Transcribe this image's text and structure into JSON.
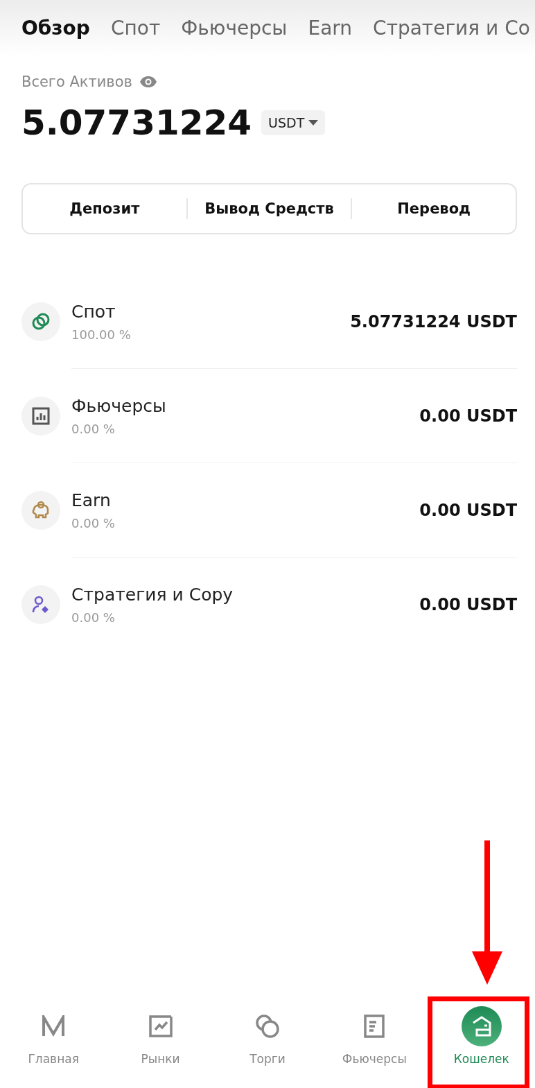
{
  "tabs": [
    {
      "label": "Обзор",
      "selected": true
    },
    {
      "label": "Спот",
      "selected": false
    },
    {
      "label": "Фьючерсы",
      "selected": false
    },
    {
      "label": "Earn",
      "selected": false
    },
    {
      "label": "Стратегия и Co",
      "selected": false
    }
  ],
  "total": {
    "label": "Всего Активов",
    "amount": "5.07731224",
    "currency": "USDT"
  },
  "actions": [
    "Депозит",
    "Вывод Средств",
    "Перевод"
  ],
  "accounts": [
    {
      "kind": "spot",
      "name": "Спот",
      "share": "100.00 %",
      "balance": "5.07731224 USDT"
    },
    {
      "kind": "futures",
      "name": "Фьючерсы",
      "share": "0.00 %",
      "balance": "0.00 USDT"
    },
    {
      "kind": "earn",
      "name": "Earn",
      "share": "0.00 %",
      "balance": "0.00 USDT"
    },
    {
      "kind": "copy",
      "name": "Стратегия и Copy",
      "share": "0.00 %",
      "balance": "0.00 USDT"
    }
  ],
  "bottom_nav": [
    {
      "kind": "home",
      "label": "Главная",
      "selected": false,
      "highlighted": false
    },
    {
      "kind": "markets",
      "label": "Рынки",
      "selected": false,
      "highlighted": false
    },
    {
      "kind": "trade",
      "label": "Торги",
      "selected": false,
      "highlighted": false
    },
    {
      "kind": "futures",
      "label": "Фьючерсы",
      "selected": false,
      "highlighted": false
    },
    {
      "kind": "wallet",
      "label": "Кошелек",
      "selected": true,
      "highlighted": true
    }
  ]
}
